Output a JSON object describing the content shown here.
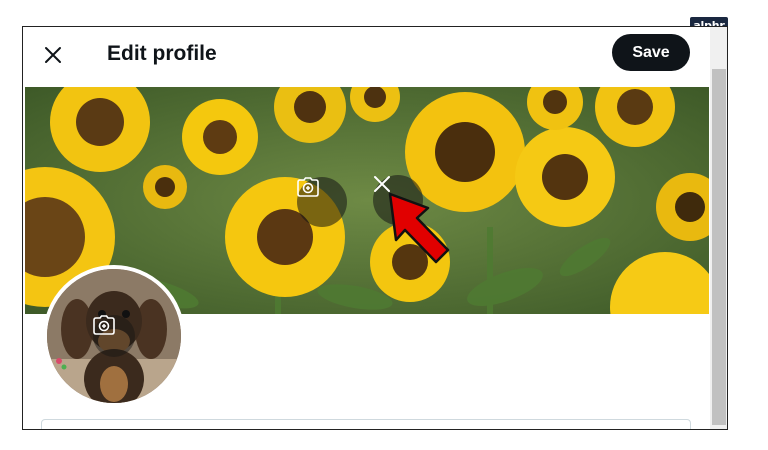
{
  "watermark": {
    "text": "alphr"
  },
  "header": {
    "close_icon": "close-icon",
    "title": "Edit profile",
    "save_label": "Save"
  },
  "banner": {
    "camera_icon": "add-photo-icon",
    "remove_icon": "close-icon"
  },
  "avatar": {
    "camera_icon": "add-photo-icon"
  },
  "form": {
    "name_value": "",
    "name_placeholder": ""
  },
  "annotation": {
    "pointer": "red-arrow-pointer",
    "color": "#e10000"
  },
  "colors": {
    "save_button_bg": "#0f1419",
    "save_button_text": "#ffffff",
    "overlay_button": "rgba(20,20,20,0.55)",
    "badge_bg": "#1a2840"
  }
}
